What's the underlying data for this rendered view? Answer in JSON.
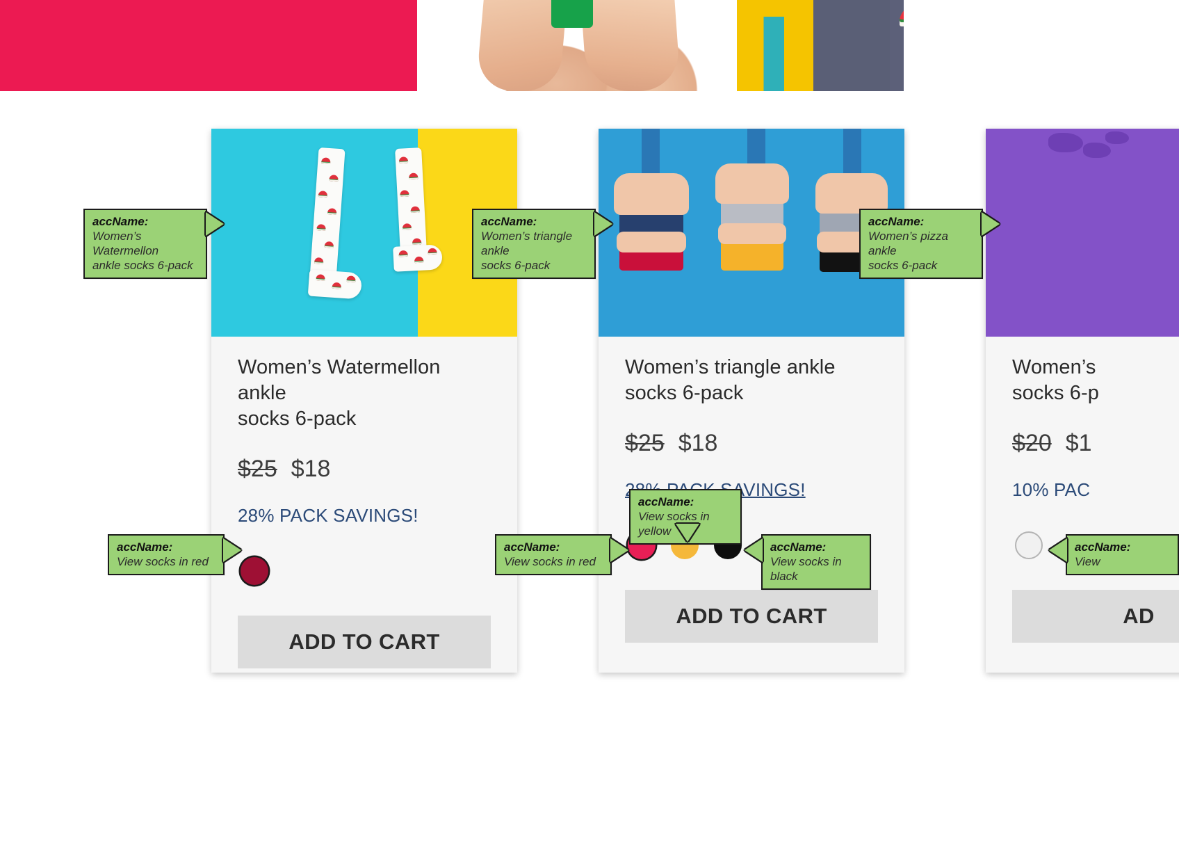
{
  "hero": {
    "background_color": "#ec1a52",
    "description": "banner photo of legs wearing colorful patterned socks"
  },
  "products": [
    {
      "id": "watermelon",
      "title": "Women’s Watermellon ankle\nsocks 6-pack",
      "price_old": "$25",
      "price_new": "$18",
      "savings": "28% PACK SAVINGS!",
      "savings_underlined": false,
      "add_to_cart": "ADD TO CART",
      "swatches": [
        {
          "name": "red",
          "color": "#9e1034",
          "selected": true,
          "outline": false
        }
      ],
      "image": {
        "left_color": "#2ec9e0",
        "right_color": "#fbd818"
      }
    },
    {
      "id": "triangle",
      "title": "Women’s triangle ankle\nsocks 6-pack",
      "price_old": "$25",
      "price_new": "$18",
      "savings": "28% PACK SAVINGS!",
      "savings_underlined": true,
      "add_to_cart": "ADD TO CART",
      "swatches": [
        {
          "name": "red",
          "color": "#e81f56",
          "selected": true,
          "outline": false
        },
        {
          "name": "yellow",
          "color": "#f5b83a",
          "selected": false,
          "outline": false
        },
        {
          "name": "black",
          "color": "#0d0d0d",
          "selected": false,
          "outline": false
        }
      ],
      "image": {
        "background_color": "#2f9ed6"
      }
    },
    {
      "id": "pizza",
      "title": "Women’s\nsocks 6-p",
      "price_old": "$20",
      "price_new": "$1",
      "savings": "10% PAC",
      "savings_underlined": false,
      "add_to_cart": "AD",
      "swatches": [
        {
          "name": "white",
          "color": "#f1f1f1",
          "selected": false,
          "outline": true
        }
      ],
      "image": {
        "background_color": "#8352c8"
      }
    }
  ],
  "annotations": [
    {
      "id": "acc-1-title",
      "label": "accName:",
      "value": "Women’s Watermellon\nankle socks 6-pack",
      "arrow": "right"
    },
    {
      "id": "acc-2-title",
      "label": "accName:",
      "value": "Women’s triangle ankle\nsocks 6-pack",
      "arrow": "right"
    },
    {
      "id": "acc-3-title",
      "label": "accName:",
      "value": "Women’s pizza ankle\nsocks 6-pack",
      "arrow": "right"
    },
    {
      "id": "acc-1-red",
      "label": "accName:",
      "value": "View socks in red",
      "arrow": "right"
    },
    {
      "id": "acc-2-red",
      "label": "accName:",
      "value": "View socks in red",
      "arrow": "right"
    },
    {
      "id": "acc-2-yellow",
      "label": "accName:",
      "value": "View socks in yellow",
      "arrow": "down"
    },
    {
      "id": "acc-2-black",
      "label": "accName:",
      "value": "View socks in black",
      "arrow": "left"
    },
    {
      "id": "acc-3-white",
      "label": "accName:",
      "value": "View",
      "arrow": "left"
    }
  ],
  "colors": {
    "callout_bg": "#9bd276",
    "callout_border": "#1b1b1b",
    "card_bg": "#f6f6f6",
    "button_bg": "#dcdcdc",
    "savings_text": "#2b4a78"
  }
}
